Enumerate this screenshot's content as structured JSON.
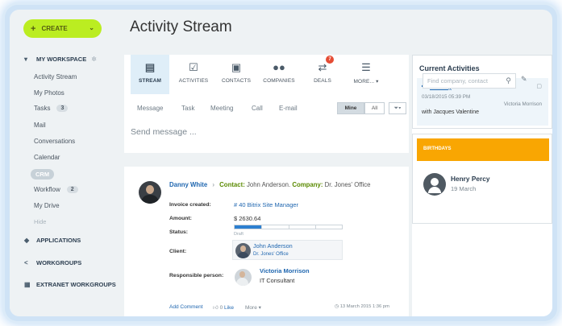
{
  "sidebar": {
    "create_label": "CREATE",
    "my_workspace": "MY WORKSPACE",
    "items": [
      {
        "label": "Activity Stream"
      },
      {
        "label": "My Photos"
      },
      {
        "label": "Tasks",
        "badge": "3"
      },
      {
        "label": "Mail"
      },
      {
        "label": "Conversations"
      },
      {
        "label": "Calendar"
      },
      {
        "label": "CRM"
      },
      {
        "label": "Workflow",
        "badge": "2"
      },
      {
        "label": "My Drive"
      },
      {
        "label": "Hide"
      }
    ],
    "sections": {
      "applications": "APPLICATIONS",
      "workgroups": "WORKGROUPS",
      "extranet": "EXTRANET WORKGROUPS"
    }
  },
  "page_title": "Activity Stream",
  "tabs": [
    {
      "label": "STREAM",
      "icon": "stream-icon"
    },
    {
      "label": "ACTIVITIES",
      "icon": "activities-icon"
    },
    {
      "label": "CONTACTS",
      "icon": "contacts-icon"
    },
    {
      "label": "COMPANIES",
      "icon": "companies-icon"
    },
    {
      "label": "DEALS",
      "icon": "deals-icon",
      "badge": "7"
    },
    {
      "label": "MORE...",
      "icon": "more-icon"
    }
  ],
  "search": {
    "placeholder": "Find company, contact"
  },
  "post_types": [
    "Message",
    "Task",
    "Meeting",
    "Call",
    "E-mail"
  ],
  "filters": {
    "mine": "Mine",
    "all": "All"
  },
  "composer": {
    "placeholder": "Send message ..."
  },
  "post": {
    "author": "Danny White",
    "contact_label": "Contact:",
    "contact_value": "John Anderson.",
    "company_label": "Company:",
    "company_value": "Dr. Jones' Office",
    "invoice_label": "Invoice created:",
    "invoice_value": "# 40 Bitrix Site Manager",
    "amount_label": "Amount:",
    "amount_value": "$ 2630.64",
    "status_label": "Status:",
    "status_stage": "Draft",
    "status_progress": 0.25,
    "client_label": "Client:",
    "client_name": "John Anderson",
    "client_company": "Dr. Jones' Office",
    "responsible_label": "Responsible person:",
    "responsible_name": "Victoria Morrison",
    "responsible_title": "IT Consultant",
    "add_comment": "Add Comment",
    "likes": "0",
    "like_label": "Like",
    "more_label": "More",
    "timestamp": "13 March 2015 1:36 pm"
  },
  "current_activities": {
    "title": "Current Activities",
    "type": "Meeting",
    "datetime": "03/18/2015 05:39 PM",
    "owner": "Victoria Morrison",
    "desc": "with Jacques Valentine"
  },
  "birthdays": {
    "title": "BIRTHDAYS",
    "name": "Henry Percy",
    "date": "19 March"
  },
  "colors": {
    "accent": "#bbed21",
    "link": "#2067b0",
    "birthday": "#f9a602",
    "badge": "#e54c34"
  }
}
